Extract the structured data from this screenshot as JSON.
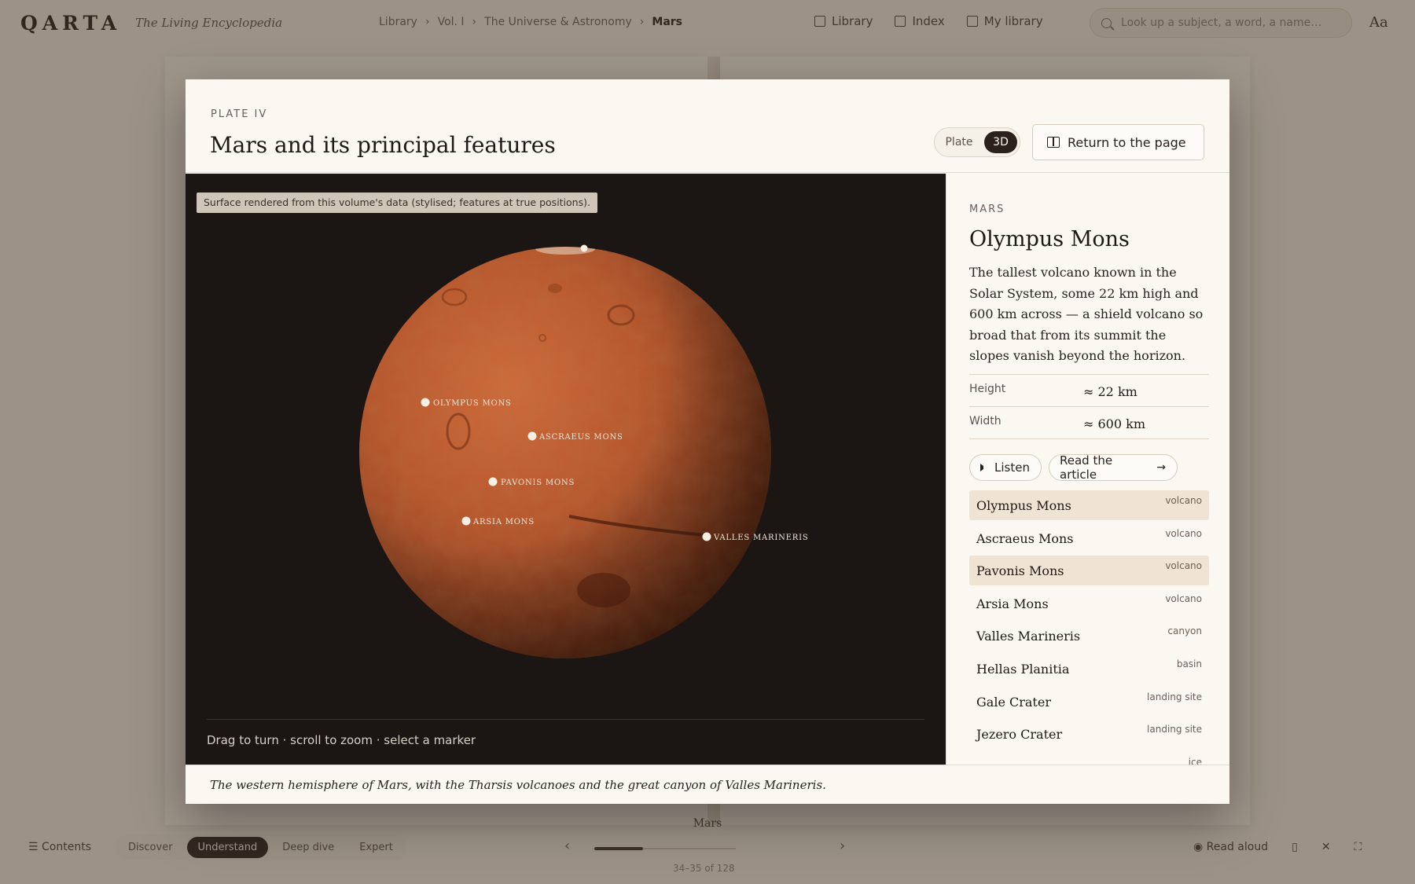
{
  "app": {
    "brand": "QARTA",
    "tagline": "The Living Encyclopedia",
    "breadcrumb": [
      "Library",
      "Vol. I",
      "The Universe & Astronomy",
      "Mars"
    ],
    "nav": [
      "Library",
      "Index",
      "My library"
    ],
    "search_placeholder": "Look up a subject, a word, a name…",
    "account_icon": "Aa",
    "book_footer": "Mars",
    "bottom": {
      "contents_label": "Contents",
      "modes": [
        "Discover",
        "Understand",
        "Deep dive",
        "Expert"
      ],
      "active_mode": "Understand",
      "page_counter": "34–35 of 128",
      "read_aloud": "Read aloud"
    }
  },
  "modal": {
    "plate_label": "PLATE IV",
    "title": "Mars and its principal features",
    "view_toggle": {
      "options": [
        "Plate",
        "3D"
      ],
      "selected": "3D"
    },
    "return_label": "Return to the page",
    "viewer_note": "Surface rendered from this volume's data (stylised; features at true positions).",
    "viewer_hint": "Drag to turn · scroll to zoom · select a marker",
    "markers": [
      {
        "label": "OLYMPUS MONS"
      },
      {
        "label": "ASCRAEUS MONS"
      },
      {
        "label": "PAVONIS MONS"
      },
      {
        "label": "ARSIA MONS"
      },
      {
        "label": "VALLES MARINERIS"
      }
    ],
    "panel": {
      "kicker": "MARS",
      "title": "Olympus Mons",
      "description": "The tallest volcano known in the Solar System, some 22 km high and 600 km across — a shield volcano so broad that from its summit the slopes vanish beyond the horizon.",
      "facts": [
        {
          "key": "Height",
          "value": "≈ 22 km"
        },
        {
          "key": "Width",
          "value": "≈ 600 km"
        }
      ],
      "listen_label": "Listen",
      "read_label": "Read the article",
      "features": [
        {
          "name": "Olympus Mons",
          "type": "volcano"
        },
        {
          "name": "Ascraeus Mons",
          "type": "volcano"
        },
        {
          "name": "Pavonis Mons",
          "type": "volcano"
        },
        {
          "name": "Arsia Mons",
          "type": "volcano"
        },
        {
          "name": "Valles Marineris",
          "type": "canyon"
        },
        {
          "name": "Hellas Planitia",
          "type": "basin"
        },
        {
          "name": "Gale Crater",
          "type": "landing site"
        },
        {
          "name": "Jezero Crater",
          "type": "landing site"
        },
        {
          "name": "",
          "type": "ice"
        }
      ]
    },
    "caption": "The western hemisphere of Mars, with the Tharsis volcanoes and the great canyon of Valles Marineris."
  },
  "colors": {
    "accent_dark": "#2a211c",
    "paper": "#fbf8f1",
    "viewer_bg": "#1b1613",
    "mars_surface": "#b8562c",
    "selected_row": "#efe3d3"
  }
}
